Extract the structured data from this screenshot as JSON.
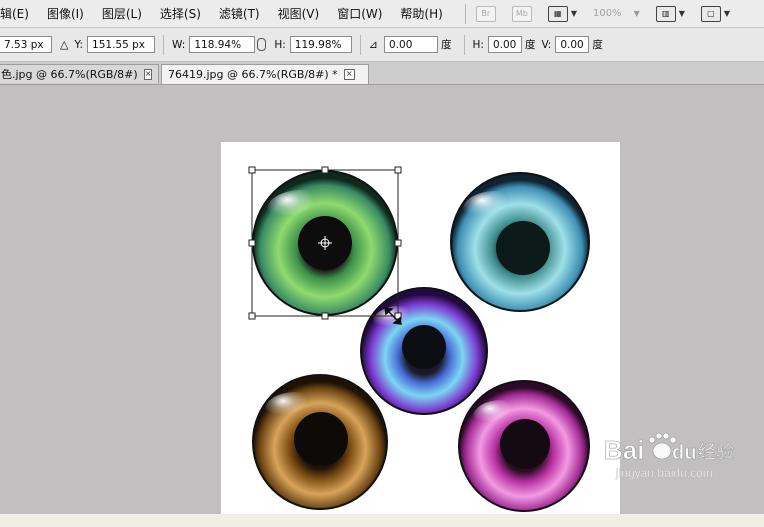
{
  "menu": [
    "辑(E)",
    "图像(I)",
    "图层(L)",
    "选择(S)",
    "滤镜(T)",
    "视图(V)",
    "窗口(W)",
    "帮助(H)"
  ],
  "toolbar": {
    "br": "Br",
    "mb": "Mb",
    "zoom": "100%"
  },
  "options": {
    "x_value": "7.53 px",
    "y_label": "Y:",
    "y_value": "151.55 px",
    "w_label": "W:",
    "w_value": "118.94%",
    "h_label": "H:",
    "h_value": "119.98%",
    "rotate_value": "0.00",
    "rotate_unit": "度",
    "hskew_label": "H:",
    "hskew_value": "0.00",
    "hskew_unit": "度",
    "vskew_label": "V:",
    "vskew_value": "0.00",
    "vskew_unit": "度"
  },
  "tabs": [
    {
      "label": "色.jpg @ 66.7%(RGB/8#)"
    },
    {
      "label": "76419.jpg @ 66.7%(RGB/8#) *"
    }
  ],
  "watermark": {
    "brand": "Bai",
    "brand2": "du",
    "cn": "经验",
    "url": "jingyan.baidu.com"
  },
  "colors": {
    "menubar": "#ececec",
    "workspace": "#c1bfbf",
    "document": "#ffffff"
  }
}
